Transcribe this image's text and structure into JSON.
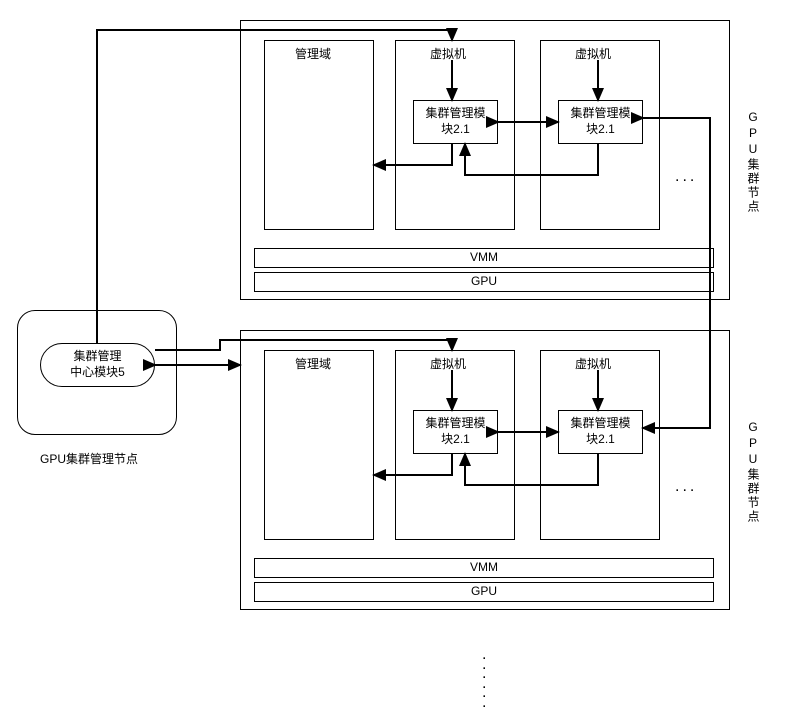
{
  "management_node": {
    "outer_label": "GPU集群管理节点",
    "center_module": "集群管理\n中心模块5"
  },
  "cluster_nodes": [
    {
      "side_label": "GPU集群节点",
      "columns": {
        "mgmt_domain": "管理域",
        "vm1": "虚拟机",
        "vm2": "虚拟机"
      },
      "module1": "集群管理模\n块2.1",
      "module2": "集群管理模\n块2.1",
      "vmm": "VMM",
      "gpu": "GPU"
    },
    {
      "side_label": "GPU集群节点",
      "columns": {
        "mgmt_domain": "管理域",
        "vm1": "虚拟机",
        "vm2": "虚拟机"
      },
      "module1": "集群管理模\n块2.1",
      "module2": "集群管理模\n块2.1",
      "vmm": "VMM",
      "gpu": "GPU"
    }
  ]
}
